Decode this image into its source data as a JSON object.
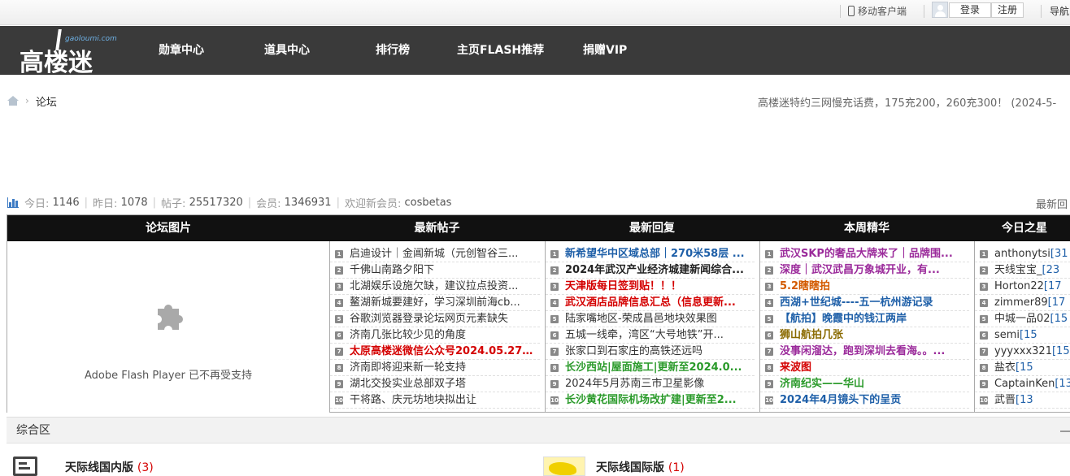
{
  "topbar": {
    "mobile": "移动客户端",
    "login": "登录",
    "register": "注册",
    "nav": "导航"
  },
  "header": {
    "logo_cn": "高楼迷",
    "logo_en": "gaoloumi.com",
    "nav": [
      "勋章中心",
      "道具中心",
      "排行榜",
      "主页FLASH推荐",
      "捐赠VIP"
    ]
  },
  "breadcrumb": {
    "current": "论坛"
  },
  "notice": "高楼迷特约三网慢充话费，175充200，260充300！ (2024-5-",
  "stats": {
    "today_label": "今日:",
    "today": "1146",
    "yesterday_label": "昨日:",
    "yesterday": "1078",
    "posts_label": "帖子:",
    "posts": "25517320",
    "members_label": "会员:",
    "members": "1346931",
    "welcome_label": "欢迎新会员:",
    "newest": "cosbetas",
    "latest_reply": "最新回"
  },
  "grid": {
    "headers": [
      "论坛图片",
      "最新帖子",
      "最新回复",
      "本周精华",
      "今日之星"
    ],
    "flash_message": "Adobe Flash Player 已不再受支持",
    "new_posts": [
      {
        "n": "1",
        "text": "启迪设计｜金阊新城（元创智谷三...",
        "style": ""
      },
      {
        "n": "2",
        "text": "千佛山南路夕阳下",
        "style": ""
      },
      {
        "n": "3",
        "text": "北湖娱乐设施欠缺，建议拉点投资...",
        "style": ""
      },
      {
        "n": "4",
        "text": "鳌湖新城要建好，学习深圳前海cb...",
        "style": ""
      },
      {
        "n": "5",
        "text": "谷歌浏览器登录论坛网页元素缺失",
        "style": ""
      },
      {
        "n": "6",
        "text": "济南几张比较少见的角度",
        "style": ""
      },
      {
        "n": "7",
        "text": "太原高楼迷微信公众号2024.05.27...",
        "style": "red"
      },
      {
        "n": "8",
        "text": "济南即将迎来新一轮支持",
        "style": ""
      },
      {
        "n": "9",
        "text": "湖北交投实业总部双子塔",
        "style": ""
      },
      {
        "n": "10",
        "text": "干将路、庆元坊地块拟出让",
        "style": ""
      }
    ],
    "new_replies": [
      {
        "n": "1",
        "text": "新希望华中区域总部｜270米58层 ...",
        "style": "blue"
      },
      {
        "n": "2",
        "text": "2024年武汉产业经济城建新闻综合...",
        "style": "dark"
      },
      {
        "n": "3",
        "text": "天津版每日签到贴！！！",
        "style": "red"
      },
      {
        "n": "4",
        "text": "武汉酒店品牌信息汇总（信息更新...",
        "style": "red"
      },
      {
        "n": "5",
        "text": "陆家嘴地区-荣成昌邑地块效果图",
        "style": ""
      },
      {
        "n": "6",
        "text": "五城一线牵，湾区“大号地铁”开...",
        "style": ""
      },
      {
        "n": "7",
        "text": "张家口到石家庄的高铁还远吗",
        "style": ""
      },
      {
        "n": "8",
        "text": "长沙西站|屋面施工|更新至2024.0...",
        "style": "green"
      },
      {
        "n": "9",
        "text": "2024年5月苏南三市卫星影像",
        "style": ""
      },
      {
        "n": "10",
        "text": "长沙黄花国际机场改扩建|更新至2...",
        "style": "green"
      }
    ],
    "weekly": [
      {
        "n": "1",
        "text": "武汉SKP的奢品大牌来了｜品牌围...",
        "style": "purple"
      },
      {
        "n": "2",
        "text": "深度｜武汉武昌万象城开业，有...",
        "style": "purple"
      },
      {
        "n": "3",
        "text": "5.2瞎瞎拍",
        "style": "orange"
      },
      {
        "n": "4",
        "text": "西湖+世纪城----五一杭州游记录",
        "style": "blue"
      },
      {
        "n": "5",
        "text": "【航拍】晚霞中的钱江两岸",
        "style": "blue"
      },
      {
        "n": "6",
        "text": "狮山航拍几张",
        "style": "olive"
      },
      {
        "n": "7",
        "text": "没事闲溜达，跑到深圳去看海。。...",
        "style": "purple"
      },
      {
        "n": "8",
        "text": "来波图",
        "style": "red"
      },
      {
        "n": "9",
        "text": "济南纪实——华山",
        "style": "green"
      },
      {
        "n": "10",
        "text": "2024年4月镜头下的呈贡",
        "style": "blue"
      }
    ],
    "stars": [
      {
        "n": "1",
        "text": "anthonytsi",
        "count": "[31"
      },
      {
        "n": "2",
        "text": "天线宝宝_",
        "count": "[23"
      },
      {
        "n": "3",
        "text": "Horton22",
        "count": "[17"
      },
      {
        "n": "4",
        "text": "zimmer89",
        "count": "[17"
      },
      {
        "n": "5",
        "text": "中城一品02",
        "count": "[15"
      },
      {
        "n": "6",
        "text": "semi",
        "count": "[15"
      },
      {
        "n": "7",
        "text": "yyyxxx321",
        "count": "[15"
      },
      {
        "n": "8",
        "text": "盐衣",
        "count": "[15"
      },
      {
        "n": "9",
        "text": "CaptainKen",
        "count": "[13"
      },
      {
        "n": "10",
        "text": "武晋",
        "count": "[13"
      }
    ]
  },
  "section": {
    "title": "综合区",
    "forums": [
      {
        "name": "天际线国内版",
        "count": "(3)"
      },
      {
        "name": "天际线国际版",
        "count": "(1)"
      }
    ]
  }
}
